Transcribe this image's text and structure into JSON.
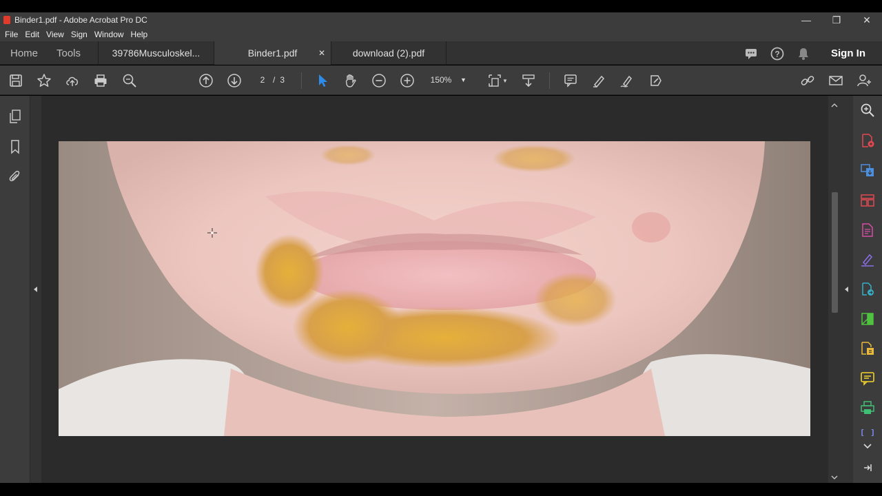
{
  "window": {
    "title": "Binder1.pdf - Adobe Acrobat Pro DC",
    "minimize": "—",
    "restore": "❐",
    "close": "✕"
  },
  "menu": [
    "File",
    "Edit",
    "View",
    "Sign",
    "Window",
    "Help"
  ],
  "tabs": {
    "home": "Home",
    "tools": "Tools",
    "docs": [
      {
        "label": "39786Musculoskel...",
        "active": false
      },
      {
        "label": "Binder1.pdf",
        "active": true,
        "close": "✕"
      },
      {
        "label": "download (2).pdf",
        "active": false
      }
    ],
    "sign_in": "Sign In"
  },
  "toolbar": {
    "page_current": "2",
    "page_sep": "/",
    "page_total": "3",
    "zoom": "150%"
  },
  "colors": {
    "accent_select": "#2d8ceb",
    "rightpanel_icons": [
      "#e34850",
      "#4b8fe0",
      "#e34850",
      "#d84ca6",
      "#8c6ee6",
      "#35b0c9",
      "#4fc33f",
      "#e8b93a",
      "#f3d32b",
      "#3fbf73",
      "#7c8cf0"
    ]
  },
  "icons": {
    "left_panel": [
      "pages-icon",
      "bookmark-icon",
      "attachment-icon"
    ],
    "right_panel": [
      "search-zoom-icon",
      "export-pdf-icon",
      "create-pdf-icon",
      "organize-pages-icon",
      "edit-pdf-icon",
      "fill-sign-icon",
      "send-for-review-icon",
      "compress-icon",
      "protect-icon",
      "comment-icon",
      "print-production-icon",
      "more-tools-icon"
    ]
  }
}
